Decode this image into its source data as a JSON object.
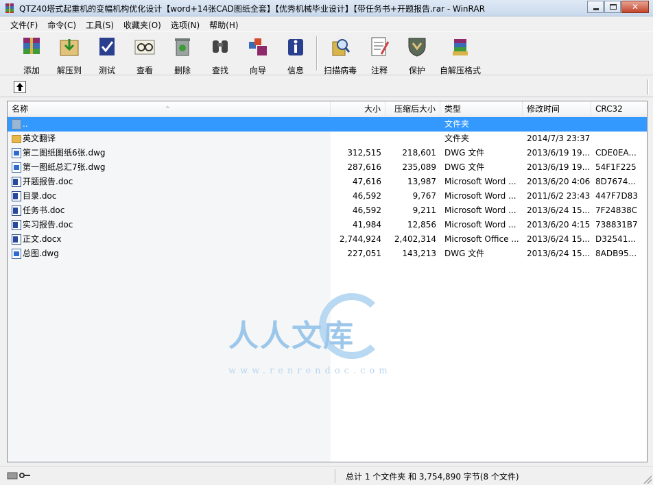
{
  "window": {
    "title": "QTZ40塔式起重机的变幅机构优化设计【word+14张CAD图纸全套】【优秀机械毕业设计】【带任务书+开题报告.rar - WinRAR",
    "close_glyph": "✕"
  },
  "menu": [
    "文件(F)",
    "命令(C)",
    "工具(S)",
    "收藏夹(O)",
    "选项(N)",
    "帮助(H)"
  ],
  "toolbar": [
    {
      "name": "add",
      "label": "添加",
      "icon": "add-icon"
    },
    {
      "name": "extract",
      "label": "解压到",
      "icon": "extract-icon"
    },
    {
      "name": "test",
      "label": "测试",
      "icon": "test-icon"
    },
    {
      "name": "view",
      "label": "查看",
      "icon": "view-icon"
    },
    {
      "name": "delete",
      "label": "删除",
      "icon": "delete-icon"
    },
    {
      "name": "find",
      "label": "查找",
      "icon": "find-icon"
    },
    {
      "name": "wizard",
      "label": "向导",
      "icon": "wizard-icon"
    },
    {
      "name": "info",
      "label": "信息",
      "icon": "info-icon"
    },
    {
      "name": "virus-scan",
      "label": "扫描病毒",
      "icon": "virus-scan-icon"
    },
    {
      "name": "comment",
      "label": "注释",
      "icon": "comment-icon"
    },
    {
      "name": "protect",
      "label": "保护",
      "icon": "protect-icon"
    },
    {
      "name": "sfx",
      "label": "自解压格式",
      "icon": "sfx-icon"
    }
  ],
  "columns": [
    "名称",
    "大小",
    "压缩后大小",
    "类型",
    "修改时间",
    "CRC32"
  ],
  "sort_glyph": "^",
  "files": [
    {
      "name": "..",
      "size": "",
      "packed": "",
      "type": "文件夹",
      "modified": "",
      "crc": "",
      "icon": "up-folder-icon",
      "selected": true
    },
    {
      "name": "英文翻译",
      "size": "",
      "packed": "",
      "type": "文件夹",
      "modified": "2014/7/3 23:37",
      "crc": "",
      "icon": "folder-icon"
    },
    {
      "name": "第二图纸图纸6张.dwg",
      "size": "312,515",
      "packed": "218,601",
      "type": "DWG 文件",
      "modified": "2013/6/19 19...",
      "crc": "CDE0EA...",
      "icon": "dwg-file-icon"
    },
    {
      "name": "第一图纸总汇7张.dwg",
      "size": "287,616",
      "packed": "235,089",
      "type": "DWG 文件",
      "modified": "2013/6/19 19...",
      "crc": "54F1F225",
      "icon": "dwg-file-icon"
    },
    {
      "name": "开题报告.doc",
      "size": "47,616",
      "packed": "13,987",
      "type": "Microsoft Word ...",
      "modified": "2013/6/20 4:06",
      "crc": "8D7674...",
      "icon": "word-file-icon"
    },
    {
      "name": "目录.doc",
      "size": "46,592",
      "packed": "9,767",
      "type": "Microsoft Word ...",
      "modified": "2011/6/2 23:43",
      "crc": "447F7D83",
      "icon": "word-file-icon"
    },
    {
      "name": "任务书.doc",
      "size": "46,592",
      "packed": "9,211",
      "type": "Microsoft Word ...",
      "modified": "2013/6/24 15...",
      "crc": "7F24838C",
      "icon": "word-file-icon"
    },
    {
      "name": "实习报告.doc",
      "size": "41,984",
      "packed": "12,856",
      "type": "Microsoft Word ...",
      "modified": "2013/6/20 4:15",
      "crc": "738831B7",
      "icon": "word-file-icon"
    },
    {
      "name": "正文.docx",
      "size": "2,744,924",
      "packed": "2,402,314",
      "type": "Microsoft Office ...",
      "modified": "2013/6/24 15...",
      "crc": "D32541...",
      "icon": "word-file-icon"
    },
    {
      "name": "总图.dwg",
      "size": "227,051",
      "packed": "143,213",
      "type": "DWG 文件",
      "modified": "2013/6/24 15...",
      "crc": "8ADB95...",
      "icon": "dwg-file-icon"
    }
  ],
  "watermark": {
    "text": "人人文库",
    "url": "www.renrendoc.com"
  },
  "status": "总计 1 个文件夹 和 3,754,890 字节(8 个文件)"
}
